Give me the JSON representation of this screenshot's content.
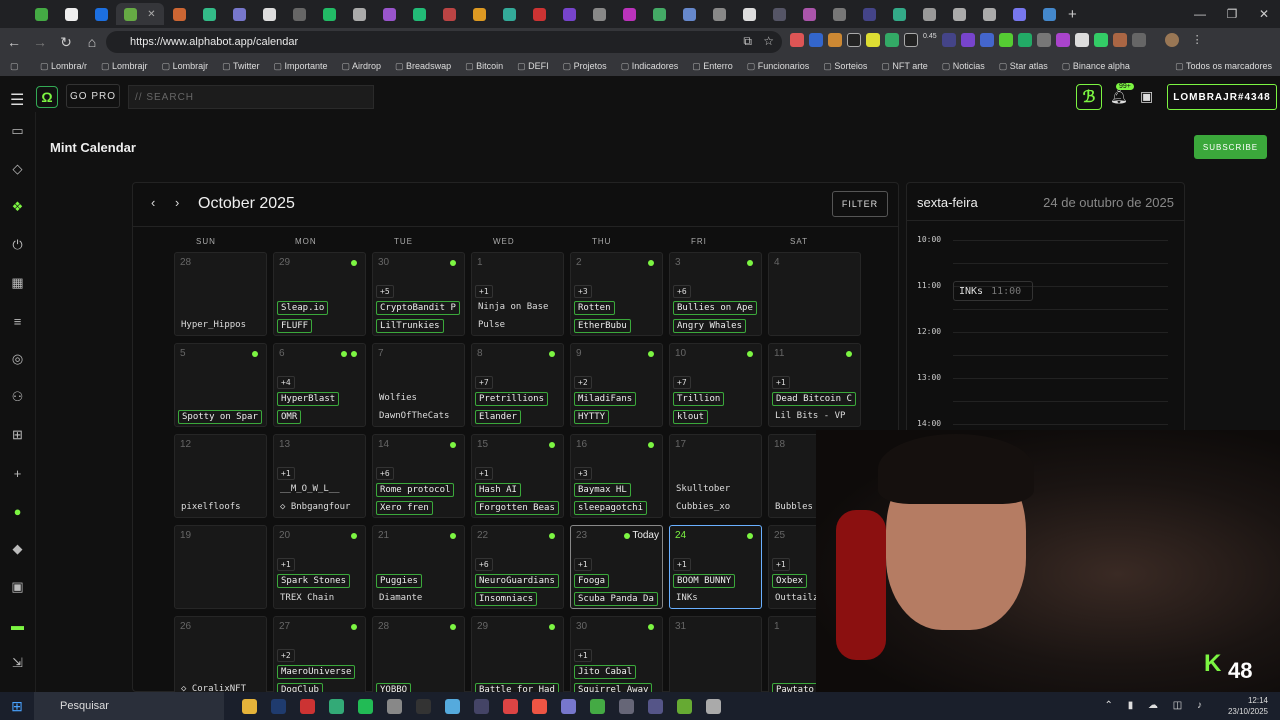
{
  "browser": {
    "url": "https://www.alphabot.app/calendar",
    "bookmarks": [
      "Lombra/r",
      "Lombrajr",
      "Lombrajr",
      "Twitter",
      "Importante",
      "Airdrop",
      "Breadswap",
      "Bitcoin",
      "DEFI",
      "Projetos",
      "Indicadores",
      "Enterro",
      "Funcionarios",
      "Sorteios",
      "NFT arte",
      "Noticias",
      "Star atlas",
      "Binance alpha"
    ],
    "bookmarks_all": "Todos os marcadores",
    "ext_badge": "0.45"
  },
  "app": {
    "gopro": "GO PRO",
    "search_placeholder": "// SEARCH",
    "notif_badge": "99+",
    "user": "LOMBRAJR#4348",
    "page_title": "Mint Calendar",
    "subscribe": "SUBSCRIBE"
  },
  "calendar": {
    "month": "October 2025",
    "filter": "FILTER",
    "today_label": "Today",
    "weekdays": [
      "SUN",
      "MON",
      "TUE",
      "WED",
      "THU",
      "FRI",
      "SAT"
    ],
    "weeks": [
      [
        {
          "d": "28",
          "more": "",
          "e": [
            "",
            "Hyper_Hippos"
          ],
          "g": [
            false,
            false
          ],
          "dot": 0
        },
        {
          "d": "29",
          "more": "",
          "e": [
            "Sleap.io",
            "FLUFF"
          ],
          "g": [
            true,
            true
          ],
          "dot": 1
        },
        {
          "d": "30",
          "more": "+5",
          "e": [
            "CryptoBandit P",
            "LilTrunkies"
          ],
          "g": [
            true,
            true
          ],
          "dot": 1
        },
        {
          "d": "1",
          "more": "+1",
          "e": [
            "Ninja on Base",
            "Pulse"
          ],
          "g": [
            false,
            false
          ],
          "dot": 0
        },
        {
          "d": "2",
          "more": "+3",
          "e": [
            "Rotten",
            "EtherBubu"
          ],
          "g": [
            true,
            true
          ],
          "dot": 1
        },
        {
          "d": "3",
          "more": "+6",
          "e": [
            "Bullies on Ape",
            "Angry Whales"
          ],
          "g": [
            true,
            true
          ],
          "dot": 1
        },
        {
          "d": "4",
          "more": "",
          "e": [
            "",
            ""
          ],
          "g": [
            false,
            false
          ],
          "dot": 0
        }
      ],
      [
        {
          "d": "5",
          "more": "",
          "e": [
            "",
            "Spotty on Spar"
          ],
          "g": [
            false,
            true
          ],
          "dot": 1
        },
        {
          "d": "6",
          "more": "+4",
          "e": [
            "HyperBlast",
            "OMR"
          ],
          "g": [
            true,
            true
          ],
          "dot": 2
        },
        {
          "d": "7",
          "more": "",
          "e": [
            "Wolfies",
            "DawnOfTheCats"
          ],
          "g": [
            false,
            false
          ],
          "dot": 0
        },
        {
          "d": "8",
          "more": "+7",
          "e": [
            "Pretrillions",
            "Elander"
          ],
          "g": [
            true,
            true
          ],
          "dot": 1
        },
        {
          "d": "9",
          "more": "+2",
          "e": [
            "MiladiFans",
            "HYTTY"
          ],
          "g": [
            true,
            true
          ],
          "dot": 1
        },
        {
          "d": "10",
          "more": "+7",
          "e": [
            "Trillion",
            "klout"
          ],
          "g": [
            true,
            true
          ],
          "dot": 1
        },
        {
          "d": "11",
          "more": "+1",
          "e": [
            "Dead Bitcoin C",
            "Lil Bits - VP"
          ],
          "g": [
            true,
            false
          ],
          "dot": 1
        }
      ],
      [
        {
          "d": "12",
          "more": "",
          "e": [
            "",
            "pixelfloofs"
          ],
          "g": [
            false,
            false
          ],
          "dot": 0
        },
        {
          "d": "13",
          "more": "+1",
          "e": [
            "__M_O_W_L__",
            "◇ Bnbgangfour"
          ],
          "g": [
            false,
            false
          ],
          "dot": 0
        },
        {
          "d": "14",
          "more": "+6",
          "e": [
            "Rome protocol",
            "Xero fren"
          ],
          "g": [
            true,
            true
          ],
          "dot": 1
        },
        {
          "d": "15",
          "more": "+1",
          "e": [
            "Hash AI",
            "Forgotten Beas"
          ],
          "g": [
            true,
            true
          ],
          "dot": 1
        },
        {
          "d": "16",
          "more": "+3",
          "e": [
            "Baymax HL",
            "sleepagotchi"
          ],
          "g": [
            true,
            true
          ],
          "dot": 1
        },
        {
          "d": "17",
          "more": "",
          "e": [
            "Skulltober",
            "Cubbies_xo"
          ],
          "g": [
            false,
            false
          ],
          "dot": 0
        },
        {
          "d": "18",
          "more": "",
          "e": [
            "",
            "Bubbles"
          ],
          "g": [
            false,
            false
          ],
          "dot": 0
        }
      ],
      [
        {
          "d": "19",
          "more": "",
          "e": [
            "",
            ""
          ],
          "g": [
            false,
            false
          ],
          "dot": 0
        },
        {
          "d": "20",
          "more": "+1",
          "e": [
            "Spark Stones",
            "TREX Chain"
          ],
          "g": [
            true,
            false
          ],
          "dot": 1
        },
        {
          "d": "21",
          "more": "",
          "e": [
            "Puggies",
            "Diamante"
          ],
          "g": [
            true,
            false
          ],
          "dot": 1
        },
        {
          "d": "22",
          "more": "+6",
          "e": [
            "NeuroGuardians",
            "Insomniacs"
          ],
          "g": [
            true,
            true
          ],
          "dot": 1
        },
        {
          "d": "23",
          "more": "+1",
          "e": [
            "Fooga",
            "Scuba Panda Da"
          ],
          "g": [
            true,
            true
          ],
          "dot": 1,
          "today": true
        },
        {
          "d": "24",
          "more": "+1",
          "e": [
            "BOOM BUNNY",
            "INKs"
          ],
          "g": [
            true,
            false
          ],
          "dot": 1,
          "sel": true
        },
        {
          "d": "25",
          "more": "+1",
          "e": [
            "Oxbex",
            "Outtailz"
          ],
          "g": [
            true,
            false
          ],
          "dot": 1
        }
      ],
      [
        {
          "d": "26",
          "more": "",
          "e": [
            "",
            "◇ CoralixNFT"
          ],
          "g": [
            false,
            false
          ],
          "dot": 0
        },
        {
          "d": "27",
          "more": "+2",
          "e": [
            "MaeroUniverse",
            "DogClub"
          ],
          "g": [
            true,
            true
          ],
          "dot": 1
        },
        {
          "d": "28",
          "more": "",
          "e": [
            "",
            "YOBBO"
          ],
          "g": [
            false,
            true
          ],
          "dot": 1
        },
        {
          "d": "29",
          "more": "",
          "e": [
            "",
            "Battle for Had"
          ],
          "g": [
            false,
            true
          ],
          "dot": 1
        },
        {
          "d": "30",
          "more": "+1",
          "e": [
            "Jito Cabal",
            "Squirrel Away"
          ],
          "g": [
            true,
            true
          ],
          "dot": 1
        },
        {
          "d": "31",
          "more": "",
          "e": [
            "",
            ""
          ],
          "g": [
            false,
            false
          ],
          "dot": 0
        },
        {
          "d": "1",
          "more": "",
          "e": [
            "",
            "Pawtato"
          ],
          "g": [
            false,
            true
          ],
          "dot": 0
        }
      ]
    ]
  },
  "day_panel": {
    "weekday": "sexta-feira",
    "date": "24 de outubro de 2025",
    "hours": [
      "10:00",
      "11:00",
      "12:00",
      "13:00",
      "14:00"
    ],
    "event_name": "INKs",
    "event_time": "11:00"
  },
  "overlay": {
    "k_label": "K",
    "k_count": "48"
  },
  "taskbar": {
    "search": "Pesquisar",
    "time": "12:14",
    "date": "23/10/2025"
  },
  "colors": {
    "accent": "#7cf542",
    "selected": "#6ab0ff"
  }
}
